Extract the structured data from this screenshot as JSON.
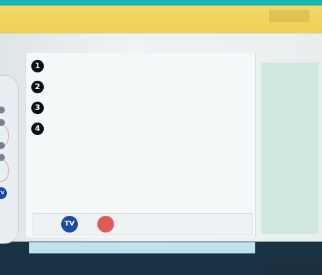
{
  "header": {
    "hint_text": "",
    "tab_label": ""
  },
  "steps": [
    {
      "number": "1",
      "text": ""
    },
    {
      "number": "2",
      "text": ""
    },
    {
      "number": "3",
      "text": ""
    },
    {
      "number": "4",
      "text": ""
    }
  ],
  "step_note": "",
  "tv_row": {
    "label": "",
    "tv_button": "TV",
    "red_label": ""
  },
  "bottom_strip": {
    "text": ""
  },
  "sidebar": {
    "items": [
      "",
      "",
      "",
      "",
      "",
      ""
    ]
  },
  "footer": {
    "text": ""
  },
  "colors": {
    "header_yellow": "#eecf53",
    "tv_blue": "#1b49a8",
    "highlight_red": "#e05a5a",
    "sidebar_green": "#cfe7dd",
    "strip_blue": "#bfe3ee"
  }
}
